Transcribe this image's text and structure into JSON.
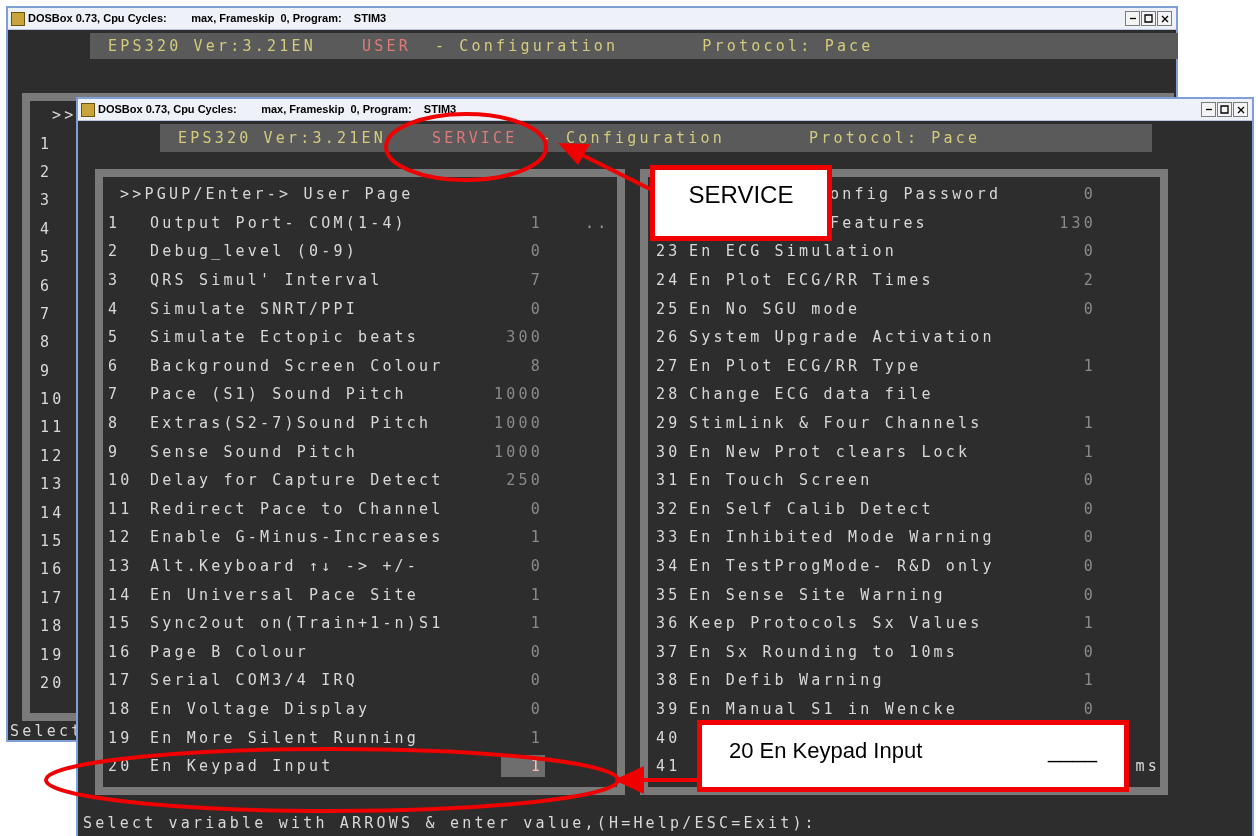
{
  "back_window": {
    "title": "DOSBox 0.73, Cpu Cycles:        max, Frameskip  0, Program:    STIM3",
    "header": {
      "product": "EPS320 Ver:3.21EN",
      "mode": "USER",
      "section": "- Configuration",
      "protocol": "Protocol: Pace"
    },
    "page_hint": ">>",
    "row_numbers": [
      "1",
      "2",
      "3",
      "4",
      "5",
      "6",
      "7",
      "8",
      "9",
      "10",
      "11",
      "12",
      "13",
      "14",
      "15",
      "16",
      "17",
      "18",
      "19",
      "20"
    ],
    "status": "Select"
  },
  "front_window": {
    "title": "DOSBox 0.73, Cpu Cycles:        max, Frameskip  0, Program:    STIM3",
    "header": {
      "product": "EPS320 Ver:3.21EN",
      "mode": "SERVICE",
      "section": "- Configuration",
      "protocol": "Protocol: Pace"
    },
    "left_column": {
      "page_hint": ">>PGUP/Enter-> User Page",
      "rows": [
        {
          "number": "1",
          "label": "Output Port- COM(1-4)",
          "value": "1",
          "note": "..",
          "selected": false
        },
        {
          "number": "2",
          "label": "Debug_level (0-9)",
          "value": "0",
          "selected": false
        },
        {
          "number": "3",
          "label": "QRS Simul' Interval",
          "value": "7",
          "selected": false
        },
        {
          "number": "4",
          "label": "Simulate SNRT/PPI",
          "value": "0",
          "selected": false
        },
        {
          "number": "5",
          "label": "Simulate Ectopic beats",
          "value": "300",
          "selected": false
        },
        {
          "number": "6",
          "label": "Background Screen Colour",
          "value": "8",
          "selected": false
        },
        {
          "number": "7",
          "label": "Pace (S1) Sound Pitch",
          "value": "1000",
          "selected": false
        },
        {
          "number": "8",
          "label": "Extras(S2-7)Sound Pitch",
          "value": "1000",
          "selected": false
        },
        {
          "number": "9",
          "label": "Sense Sound Pitch",
          "value": "1000",
          "selected": false
        },
        {
          "number": "10",
          "label": "Delay for Capture Detect",
          "value": "250",
          "selected": false
        },
        {
          "number": "11",
          "label": "Redirect Pace to Channel",
          "value": "0",
          "selected": false
        },
        {
          "number": "12",
          "label": "Enable G-Minus-Increases",
          "value": "1",
          "selected": false
        },
        {
          "number": "13",
          "label": "Alt.Keyboard ↑↓ -> +/-",
          "value": "0",
          "selected": false
        },
        {
          "number": "14",
          "label": "En Universal Pace Site",
          "value": "1",
          "selected": false
        },
        {
          "number": "15",
          "label": "Sync2out on(Train+1-n)S1",
          "value": "1",
          "selected": false
        },
        {
          "number": "16",
          "label": "Page B Colour",
          "value": "0",
          "selected": false
        },
        {
          "number": "17",
          "label": "Serial COM3/4 IRQ",
          "value": "0",
          "selected": false
        },
        {
          "number": "18",
          "label": "En Voltage Display",
          "value": "0",
          "selected": false
        },
        {
          "number": "19",
          "label": "En More Silent Running",
          "value": "1",
          "selected": false
        },
        {
          "number": "20",
          "label": "En Keypad Input",
          "value": "1",
          "selected": true
        }
      ]
    },
    "right_column": {
      "rows": [
        {
          "label": "onfig Password",
          "value": "0"
        },
        {
          "label": "Features",
          "value": "130"
        },
        {
          "number": "23",
          "label": "En ECG Simulation",
          "value": "0"
        },
        {
          "number": "24",
          "label": "En Plot ECG/RR Times",
          "value": "2"
        },
        {
          "number": "25",
          "label": "En No SGU mode",
          "value": "0"
        },
        {
          "number": "26",
          "label": "System Upgrade Activation"
        },
        {
          "number": "27",
          "label": "En Plot ECG/RR Type",
          "value": "1"
        },
        {
          "number": "28",
          "label": "Change ECG data file"
        },
        {
          "number": "29",
          "label": "StimLink & Four Channels",
          "value": "1"
        },
        {
          "number": "30",
          "label": "En New Prot clears Lock",
          "value": "1"
        },
        {
          "number": "31",
          "label": "En Touch Screen",
          "value": "0"
        },
        {
          "number": "32",
          "label": "En Self Calib Detect",
          "value": "0"
        },
        {
          "number": "33",
          "label": "En Inhibited Mode Warning",
          "value": "0"
        },
        {
          "number": "34",
          "label": "En TestProgMode- R&D only",
          "value": "0"
        },
        {
          "number": "35",
          "label": "En Sense Site Warning",
          "value": "0"
        },
        {
          "number": "36",
          "label": "Keep Protocols Sx Values",
          "value": "1"
        },
        {
          "number": "37",
          "label": "En Sx Rounding to 10ms",
          "value": "0"
        },
        {
          "number": "38",
          "label": "En Defib Warning",
          "value": "1"
        },
        {
          "number": "39",
          "label": "En Manual S1 in Wencke",
          "value": "0"
        },
        {
          "number": "40"
        },
        {
          "number": "41",
          "note": "ms"
        }
      ]
    },
    "status": "Select variable with ARROWS & enter value,(H=Help/ESC=Exit):"
  },
  "callouts": [
    {
      "text": "SERVICE"
    },
    {
      "text": "20 En Keypad Input",
      "blank": "____"
    }
  ]
}
